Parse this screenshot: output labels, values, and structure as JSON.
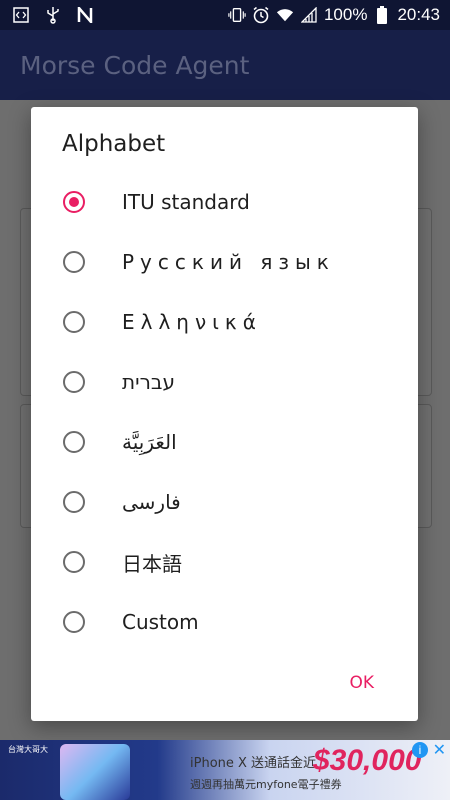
{
  "status_bar": {
    "battery_percent": "100%",
    "time": "20:43",
    "left_icons": [
      "code-icon",
      "usb-icon",
      "n-icon"
    ],
    "right_icons": [
      "vibrate-icon",
      "alarm-icon",
      "wifi-icon",
      "signal-icon",
      "battery-icon"
    ]
  },
  "app": {
    "title": "Morse Code Agent"
  },
  "dialog": {
    "title": "Alphabet",
    "options": [
      {
        "label": "ITU standard",
        "checked": true
      },
      {
        "label": "Русский язык",
        "checked": false
      },
      {
        "label": "Ελληνικά",
        "checked": false
      },
      {
        "label": "עברית",
        "checked": false
      },
      {
        "label": "العَرَبِيَّة",
        "checked": false
      },
      {
        "label": "فارسی",
        "checked": false
      },
      {
        "label": "日本語",
        "checked": false
      },
      {
        "label": "Custom",
        "checked": false
      }
    ],
    "ok_label": "OK"
  },
  "ad": {
    "brand": "台灣大哥大",
    "headline": "iPhone X 送通話金近",
    "price": "$30,000",
    "sub": "週週再抽萬元myfone電子禮券",
    "info_glyph": "i",
    "close_glyph": "✕"
  },
  "colors": {
    "accent": "#e91e63",
    "toolbar": "#171f48",
    "status_bar": "#0f1533"
  }
}
